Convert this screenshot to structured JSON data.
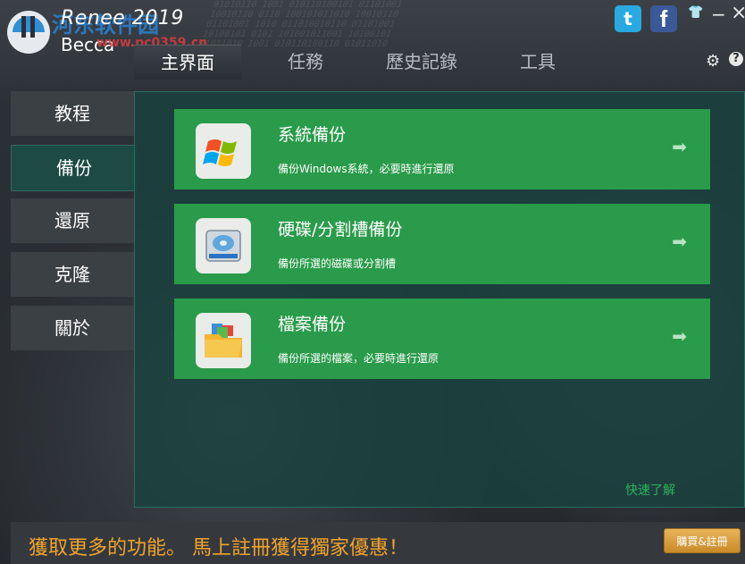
{
  "app": {
    "title": "Renee 2019",
    "subtitle": "Becca",
    "watermark": "河东软件园",
    "watermark_url": "www.pc0359.cn"
  },
  "nav": {
    "tabs": [
      {
        "label": "主界面",
        "active": true
      },
      {
        "label": "任務",
        "active": false
      },
      {
        "label": "歷史記錄",
        "active": false
      },
      {
        "label": "工具",
        "active": false
      }
    ]
  },
  "topbar": {
    "twitter_icon": "twitter-icon",
    "facebook_icon": "facebook-icon",
    "twitter_glyph": "t",
    "facebook_glyph": "f",
    "skin_glyph": "👕",
    "minimize_glyph": "−",
    "close_glyph": "×",
    "settings_glyph": "⚙",
    "help_glyph": "?"
  },
  "sidebar": {
    "items": [
      {
        "label": "教程",
        "active": false
      },
      {
        "label": "備份",
        "active": true
      },
      {
        "label": "還原",
        "active": false
      },
      {
        "label": "克隆",
        "active": false
      },
      {
        "label": "關於",
        "active": false
      }
    ]
  },
  "cards": [
    {
      "title": "系統備份",
      "desc": "備份Windows系統，必要時進行還原",
      "icon": "windows-logo-icon"
    },
    {
      "title": "硬碟/分割槽備份",
      "desc": "備份所選的磁碟或分割槽",
      "icon": "hard-disk-icon"
    },
    {
      "title": "檔案備份",
      "desc": "備份所選的檔案，必要時進行還原",
      "icon": "folder-icon"
    }
  ],
  "arrow_glyph": "➡",
  "quick_link": "快速了解",
  "promo": {
    "text": "獲取更多的功能。 馬上註冊獲得獨家優惠！",
    "buy_label": "購買&註冊"
  },
  "colors": {
    "card_green": "#299b4a",
    "panel_teal": "#18423e",
    "promo_orange": "#f0a32b"
  }
}
